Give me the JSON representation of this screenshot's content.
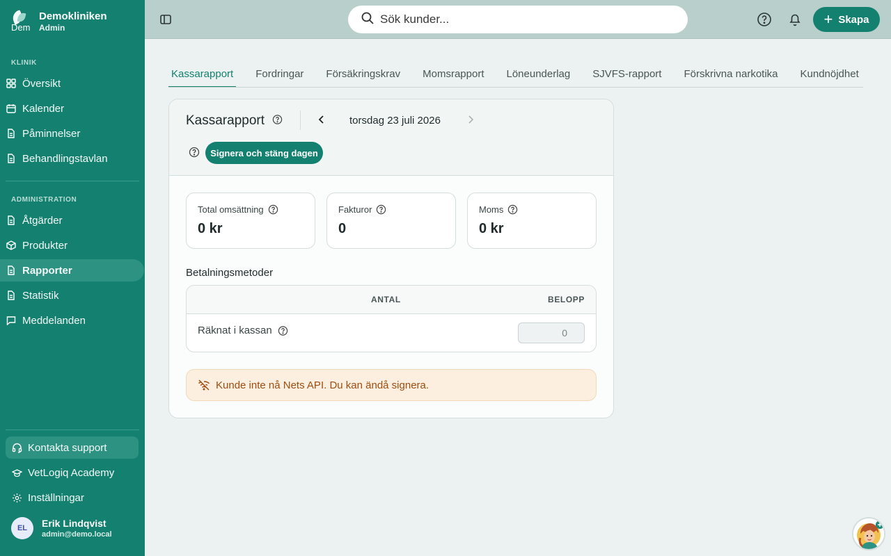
{
  "brand": {
    "logo_text": "Dem",
    "name": "Demokliniken",
    "role": "Admin"
  },
  "sidebar": {
    "section_clinic": "KLINIK",
    "clinic_items": [
      {
        "label": "Översikt",
        "icon": "dashboard-icon"
      },
      {
        "label": "Kalender",
        "icon": "calendar-icon"
      },
      {
        "label": "Påminnelser",
        "icon": "document-icon"
      },
      {
        "label": "Behandlingstavlan",
        "icon": "document-icon"
      }
    ],
    "section_admin": "ADMINISTRATION",
    "admin_items": [
      {
        "label": "Åtgärder",
        "icon": "document-icon"
      },
      {
        "label": "Produkter",
        "icon": "box-icon"
      },
      {
        "label": "Rapporter",
        "icon": "document-icon",
        "active": true
      },
      {
        "label": "Statistik",
        "icon": "document-icon"
      },
      {
        "label": "Meddelanden",
        "icon": "chat-icon"
      }
    ],
    "footer": {
      "support": "Kontakta support",
      "academy": "VetLogiq Academy",
      "settings": "Inställningar"
    },
    "user": {
      "initials": "EL",
      "name": "Erik Lindqvist",
      "email": "admin@demo.local"
    }
  },
  "header": {
    "search_placeholder": "Sök kunder...",
    "create_label": "Skapa"
  },
  "tabs": [
    "Kassarapport",
    "Fordringar",
    "Försäkringskrav",
    "Momsrapport",
    "Löneunderlag",
    "SJVFS-rapport",
    "Förskrivna narkotika",
    "Kundnöjdhet"
  ],
  "report": {
    "title": "Kassarapport",
    "date": "torsdag 23 juli 2026",
    "sign_button": "Signera och stäng dagen",
    "stats": [
      {
        "label": "Total omsättning",
        "value": "0 kr"
      },
      {
        "label": "Fakturor",
        "value": "0"
      },
      {
        "label": "Moms",
        "value": "0 kr"
      }
    ],
    "payment_methods": {
      "title": "Betalningsmetoder",
      "col_count": "ANTAL",
      "col_amount": "BELOPP",
      "counted_label": "Räknat i kassan",
      "counted_value": "0"
    },
    "alert": "Kunde inte nå Nets API. Du kan ändå signera."
  },
  "colors": {
    "primary": "#14806f",
    "header_bg": "#b8cfcb",
    "page_bg": "#ebf2f1",
    "alert_bg": "#fcefdf",
    "alert_text": "#a04d10"
  }
}
